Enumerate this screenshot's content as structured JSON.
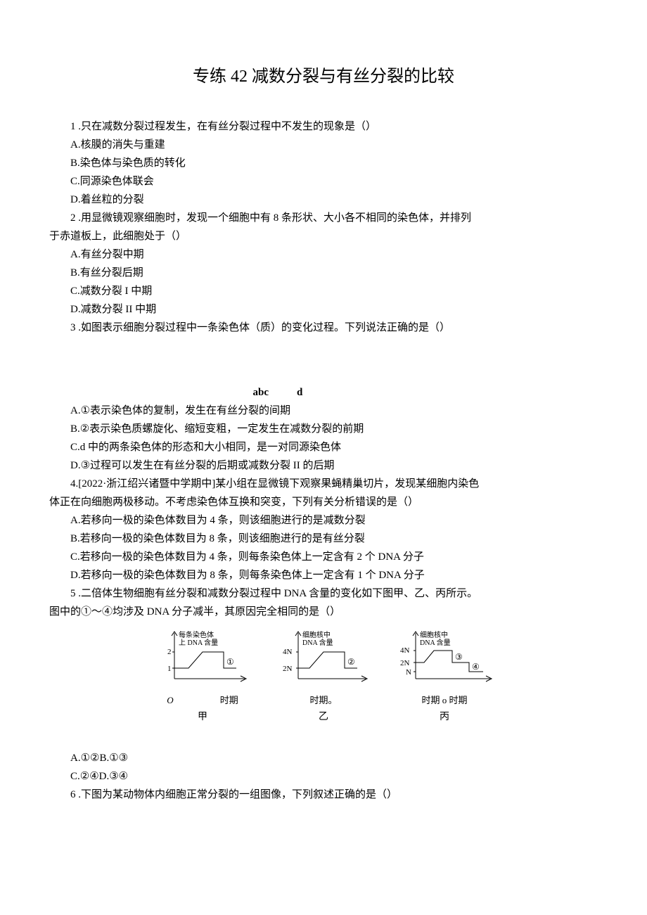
{
  "title": "专练 42 减数分裂与有丝分裂的比较",
  "q1": {
    "stem": "1 .只在减数分裂过程发生，在有丝分裂过程中不发生的现象是（）",
    "A": "A.核膜的消失与重建",
    "B": "B.染色体与染色质的转化",
    "C": "C.同源染色体联会",
    "D": "D.着丝粒的分裂"
  },
  "q2": {
    "stem1": "2 .用显微镜观察细胞时，发现一个细胞中有 8 条形状、大小各不相同的染色体，并排列",
    "stem2": "于赤道板上，此细胞处于（）",
    "A": "A.有丝分裂中期",
    "B": "B.有丝分裂后期",
    "C": "C.减数分裂 I 中期",
    "D": "D.减数分裂 II 中期"
  },
  "q3": {
    "stem": "3 .如图表示细胞分裂过程中一条染色体（质）的变化过程。下列说法正确的是（）",
    "abc": "abc",
    "d": "d",
    "A": "A.①表示染色体的复制，发生在有丝分裂的间期",
    "B": "B.②表示染色质螺旋化、缩短变粗，一定发生在减数分裂的前期",
    "C": "C.d 中的两条染色体的形态和大小相同，是一对同源染色体",
    "D": "D.③过程可以发生在有丝分裂的后期或减数分裂 II 的后期"
  },
  "q4": {
    "stem1": "4.[2022·浙江绍兴诸暨中学期中]某小组在显微镜下观察果蝇精巢切片，发现某细胞内染色",
    "stem2": "体正在向细胞两极移动。不考虑染色体互换和突变，下列有关分析错误的是（）",
    "A": "A.若移向一极的染色体数目为 4 条，则该细胞进行的是减数分裂",
    "B": "B.若移向一极的染色体数目为 8 条，则该细胞进行的是有丝分裂",
    "C": "C.若移向一极的染色体数目为 4 条，则每条染色体上一定含有 2 个 DNA 分子",
    "D": "D.若移向一极的染色体数目为 8 条，则每条染色体上一定含有 1 个 DNA 分子"
  },
  "q5": {
    "stem1": "5 .二倍体生物细胞有丝分裂和减数分裂过程中 DNA 含量的变化如下图甲、乙、丙所示。",
    "stem2": "图中的①～④均涉及 DNA 分子减半，其原因完全相同的是（）",
    "chart1": {
      "ylabel1": "每条染色体",
      "ylabel2": "上 DNA 含量",
      "t1": "2",
      "t2": "1",
      "circ": "①",
      "xlab": "O",
      "sub1": "时期",
      "sub2": "甲"
    },
    "chart2": {
      "ylabel1": "细胞核中",
      "ylabel2": "DNA 含量",
      "t1": "4N",
      "t2": "2N",
      "circ": "②",
      "sub1": "时期。",
      "sub2": "乙"
    },
    "chart3": {
      "ylabel1": "细胞核中",
      "ylabel2": "DNA 含量",
      "t1": "4N",
      "t2": "2N",
      "t3": "N",
      "c1": "③",
      "c2": "④",
      "sub1": "时期 o 时期",
      "sub2": "丙"
    },
    "opts1": "A.①②B.①③",
    "opts2": "C.②④D.③④"
  },
  "q6": {
    "stem": "6      .下图为某动物体内细胞正常分裂的一组图像，下列叙述正确的是（）"
  },
  "chart_data": [
    {
      "type": "line",
      "title": "每条染色体上 DNA 含量",
      "xlabel": "时期",
      "ylabel": "每条染色体上 DNA 含量",
      "ylim": [
        0,
        2
      ],
      "x": [
        0,
        1,
        2,
        3,
        4
      ],
      "y": [
        1,
        1,
        2,
        2,
        1
      ],
      "annotations": [
        "①"
      ],
      "name": "甲"
    },
    {
      "type": "line",
      "title": "细胞核中 DNA 含量",
      "xlabel": "时期",
      "ylabel": "细胞核中 DNA 含量",
      "ylim": [
        0,
        "4N"
      ],
      "x": [
        0,
        1,
        2,
        3,
        4
      ],
      "y": [
        "2N",
        "2N",
        "4N",
        "4N",
        "2N"
      ],
      "annotations": [
        "②"
      ],
      "name": "乙"
    },
    {
      "type": "line",
      "title": "细胞核中 DNA 含量",
      "xlabel": "时期",
      "ylabel": "细胞核中 DNA 含量",
      "ylim": [
        0,
        "4N"
      ],
      "x": [
        0,
        1,
        2,
        3,
        4,
        5,
        6
      ],
      "y": [
        "2N",
        "2N",
        "4N",
        "4N",
        "2N",
        "2N",
        "N"
      ],
      "annotations": [
        "③",
        "④"
      ],
      "name": "丙"
    }
  ]
}
